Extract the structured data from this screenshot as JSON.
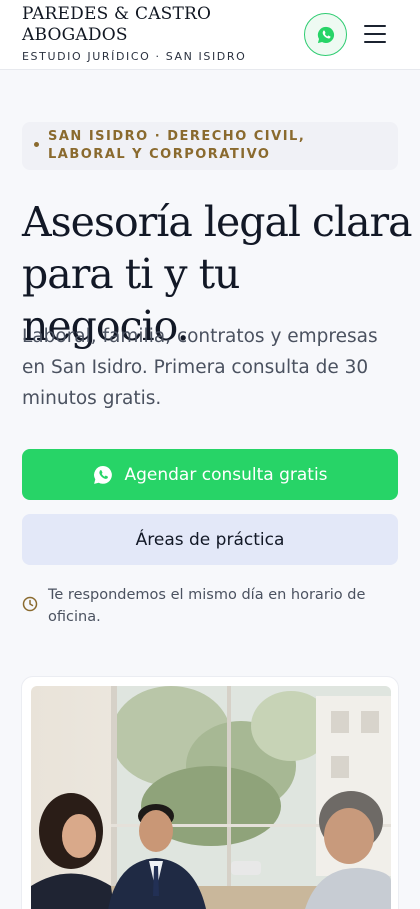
{
  "header": {
    "brand_line1": "PAREDES & CASTRO",
    "brand_line2": "ABOGADOS",
    "brand_sub": "ESTUDIO JURÍDICO · SAN ISIDRO"
  },
  "badge": {
    "text": "SAN ISIDRO · DERECHO CIVIL, LABORAL Y CORPORATIVO"
  },
  "hero": {
    "headline_line1": "Asesoría legal clara",
    "headline_line2": "para ti y tu negocio.",
    "lead": "Laboral, familia, contratos y empresas en San Isidro. Primera consulta de 30 minutos gratis."
  },
  "cta": {
    "primary_label": "Agendar consulta gratis",
    "secondary_label": "Áreas de práctica"
  },
  "note": {
    "text": "Te respondemos el mismo día en horario de oficina."
  },
  "icons": {
    "header_whatsapp": "whatsapp-icon",
    "menu": "hamburger-menu-icon",
    "cta_whatsapp": "whatsapp-icon",
    "note": "clock-icon"
  },
  "colors": {
    "accent_green": "#27d467",
    "badge_gold": "#8a6a2e",
    "secondary_button": "#e3e8f8",
    "headline": "#121826"
  }
}
